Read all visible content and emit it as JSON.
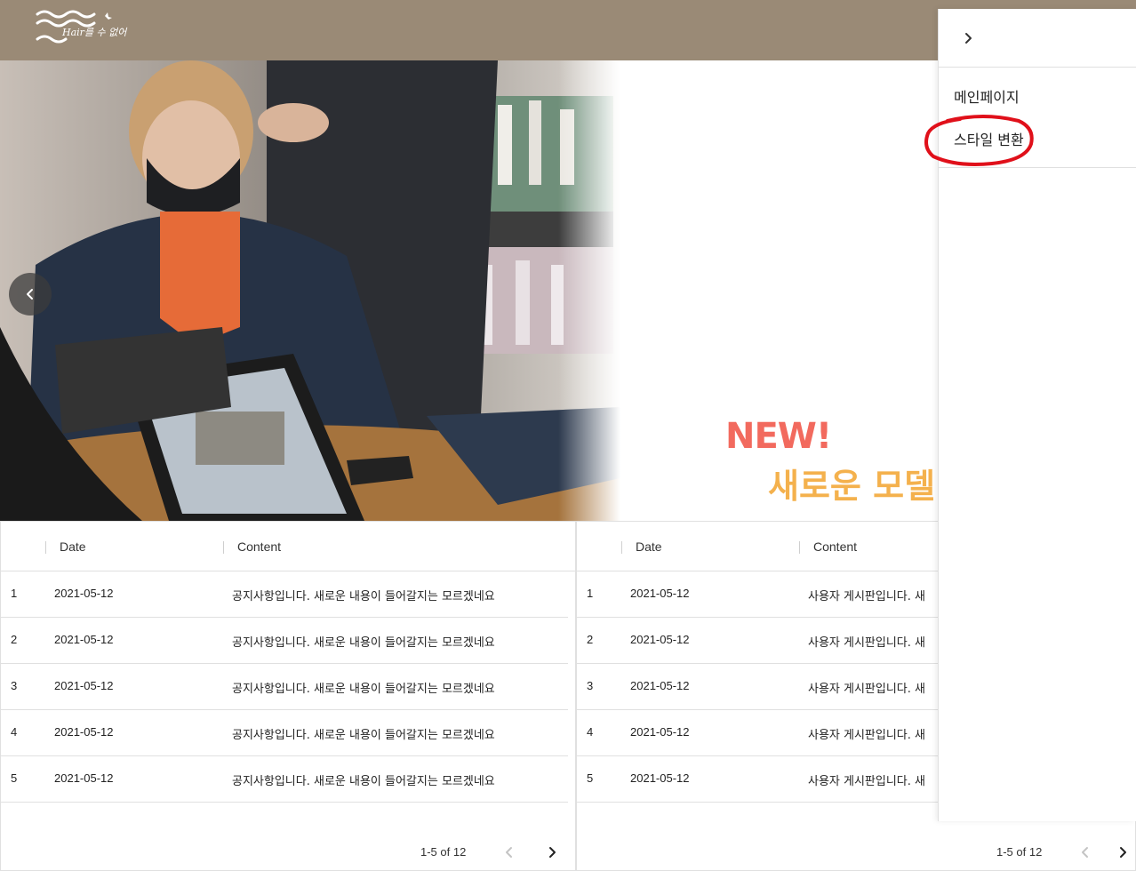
{
  "header": {
    "logo_text": "Hair를 수 없어",
    "brand_color": "#9a8a76"
  },
  "hero": {
    "banner_title": "NEW!",
    "banner_subtitle": "새로운 모델",
    "prev_icon": "chevron-left-icon"
  },
  "drawer": {
    "toggle_icon": "chevron-right-icon",
    "items": [
      {
        "label": "메인페이지"
      },
      {
        "label": "스타일 변환"
      }
    ],
    "annotation_color": "#e0101a"
  },
  "tables": [
    {
      "columns": [
        "Date",
        "Content"
      ],
      "rows": [
        {
          "id": "1",
          "date": "2021-05-12",
          "content": "공지사항입니다. 새로운 내용이 들어갈지는 모르겠네요"
        },
        {
          "id": "2",
          "date": "2021-05-12",
          "content": "공지사항입니다. 새로운 내용이 들어갈지는 모르겠네요"
        },
        {
          "id": "3",
          "date": "2021-05-12",
          "content": "공지사항입니다. 새로운 내용이 들어갈지는 모르겠네요"
        },
        {
          "id": "4",
          "date": "2021-05-12",
          "content": "공지사항입니다. 새로운 내용이 들어갈지는 모르겠네요"
        },
        {
          "id": "5",
          "date": "2021-05-12",
          "content": "공지사항입니다. 새로운 내용이 들어갈지는 모르겠네요"
        }
      ],
      "pagination": "1-5 of 12"
    },
    {
      "columns": [
        "Date",
        "Content"
      ],
      "rows": [
        {
          "id": "1",
          "date": "2021-05-12",
          "content": "사용자 게시판입니다. 새"
        },
        {
          "id": "2",
          "date": "2021-05-12",
          "content": "사용자 게시판입니다. 새"
        },
        {
          "id": "3",
          "date": "2021-05-12",
          "content": "사용자 게시판입니다. 새"
        },
        {
          "id": "4",
          "date": "2021-05-12",
          "content": "사용자 게시판입니다. 새"
        },
        {
          "id": "5",
          "date": "2021-05-12",
          "content": "사용자 게시판입니다. 새"
        }
      ],
      "pagination": "1-5 of 12"
    }
  ]
}
